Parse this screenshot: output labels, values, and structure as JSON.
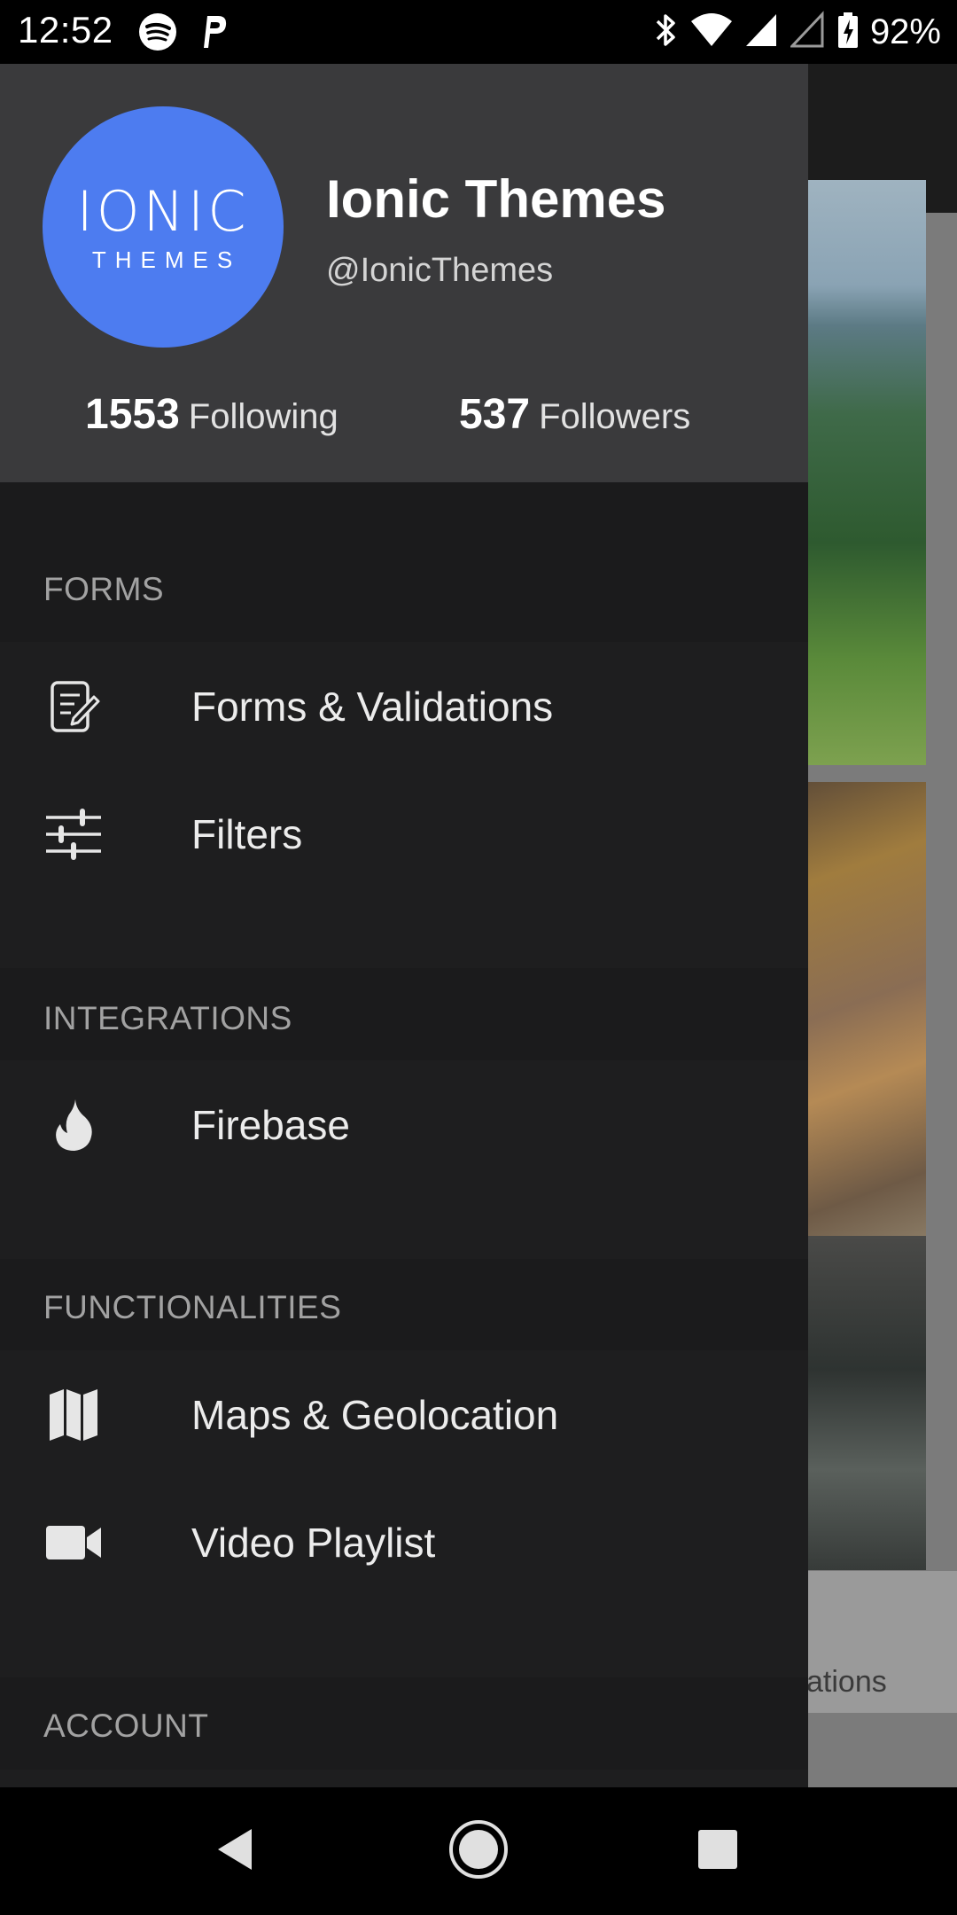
{
  "status_bar": {
    "time": "12:52",
    "battery": "92%",
    "left_icons": [
      "spotify-icon",
      "parking-icon"
    ],
    "right_icons": [
      "bluetooth-icon",
      "wifi-icon",
      "signal-icon",
      "signal-empty-icon",
      "battery-charging-icon"
    ]
  },
  "profile": {
    "logo_top": "IONIC",
    "logo_bottom": "THEMES",
    "name": "Ionic Themes",
    "handle": "@IonicThemes",
    "following_count": "1553",
    "following_label": "Following",
    "followers_count": "537",
    "followers_label": "Followers"
  },
  "sections": [
    {
      "title": "FORMS",
      "items": [
        {
          "label": "Forms & Validations",
          "icon": "document-edit-icon"
        },
        {
          "label": "Filters",
          "icon": "sliders-icon"
        }
      ]
    },
    {
      "title": "INTEGRATIONS",
      "items": [
        {
          "label": "Firebase",
          "icon": "flame-icon"
        }
      ]
    },
    {
      "title": "FUNCTIONALITIES",
      "items": [
        {
          "label": "Maps & Geolocation",
          "icon": "map-icon"
        },
        {
          "label": "Video Playlist",
          "icon": "videocam-icon"
        }
      ]
    },
    {
      "title": "ACCOUNT",
      "items": []
    }
  ],
  "background": {
    "tab_partial_label": "ations"
  },
  "nav_bar": [
    "back-icon",
    "home-icon",
    "recents-icon"
  ],
  "colors": {
    "accent": "#4d7cf0",
    "header_bg": "#3a3a3c",
    "drawer_bg": "#1b1b1c"
  }
}
